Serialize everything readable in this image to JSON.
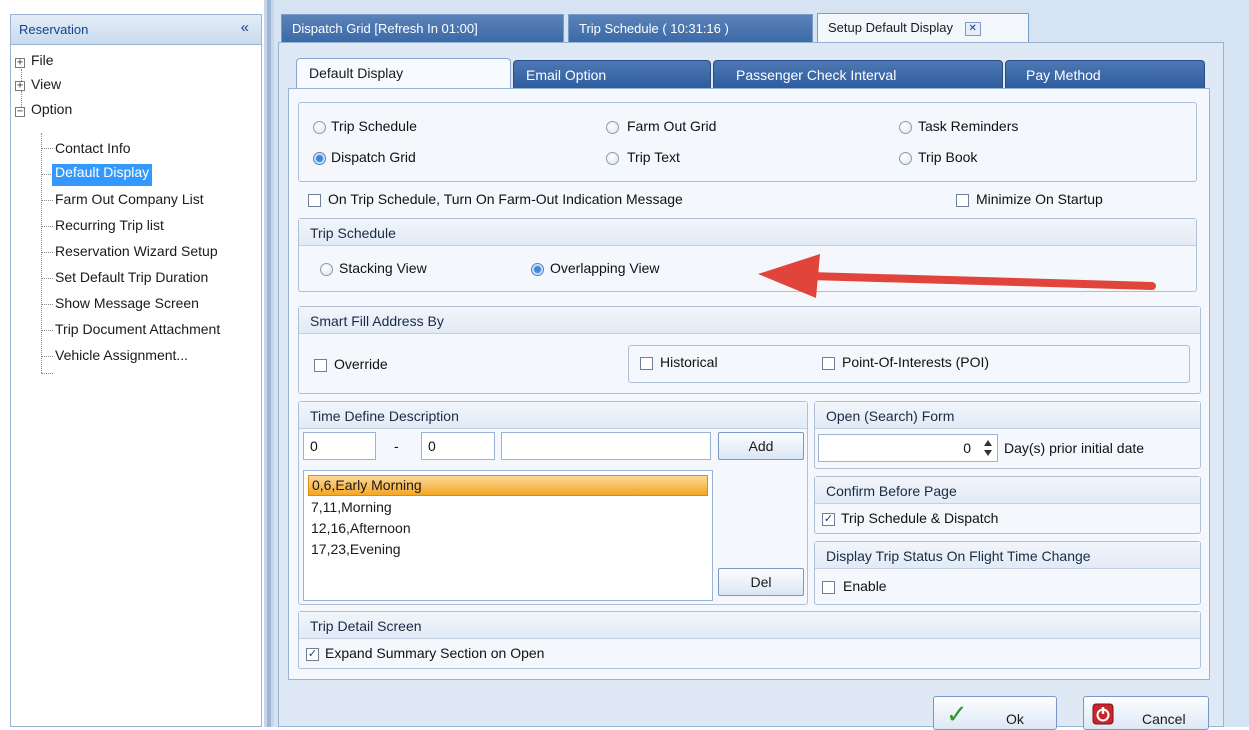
{
  "left_panel": {
    "title": "Reservation",
    "collapse_glyph": "«",
    "tree": {
      "file": "File",
      "view": "View",
      "option": "Option",
      "children": [
        "Contact Info",
        "Default Display",
        "Farm Out Company List",
        "Recurring Trip list",
        "Reservation Wizard Setup",
        "Set Default Trip Duration",
        "Show Message Screen",
        "Trip Document Attachment",
        "Vehicle Assignment..."
      ],
      "selected": "Default Display"
    }
  },
  "doc_tabs": {
    "dispatch": "Dispatch Grid [Refresh In 01:00]",
    "schedule": "Trip Schedule  ( 10:31:16 )",
    "setup": "Setup Default Display",
    "close_glyph": "✕"
  },
  "sub_tabs": {
    "default_display": "Default Display",
    "email_option": "Email Option",
    "passenger_check": "Passenger Check Interval",
    "pay_method": "Pay Method"
  },
  "default_view": {
    "trip_schedule": "Trip Schedule",
    "farm_out_grid": "Farm Out Grid",
    "task_reminders": "Task Reminders",
    "dispatch_grid": "Dispatch Grid",
    "trip_text": "Trip Text",
    "trip_book": "Trip Book",
    "selected": "Dispatch Grid"
  },
  "options": {
    "farm_out_msg": "On Trip Schedule, Turn On Farm-Out Indication Message",
    "minimize": "Minimize On Startup"
  },
  "trip_schedule_group": {
    "title": "Trip Schedule",
    "stacking": "Stacking View",
    "overlapping": "Overlapping View",
    "selected": "Overlapping View"
  },
  "smart_fill": {
    "title": "Smart Fill Address By",
    "override": "Override",
    "historical": "Historical",
    "poi": "Point-Of-Interests (POI)"
  },
  "time_define": {
    "title": "Time Define Description",
    "from": "0",
    "dash": "-",
    "to": "0",
    "description": "",
    "add_label": "Add",
    "del_label": "Del",
    "items": [
      "0,6,Early Morning",
      "7,11,Morning",
      "12,16,Afternoon",
      "17,23,Evening"
    ],
    "selected_index": 0
  },
  "open_search": {
    "title": "Open (Search) Form",
    "days_value": "0",
    "days_label": "Day(s) prior initial date"
  },
  "confirm_before_page": {
    "title": "Confirm Before Page",
    "label": "Trip Schedule & Dispatch",
    "checked": true
  },
  "flight_status": {
    "title": "Display Trip Status On Flight Time Change",
    "label": "Enable",
    "checked": false
  },
  "trip_detail": {
    "title": "Trip Detail Screen",
    "label": "Expand Summary Section on Open",
    "checked": true
  },
  "footer": {
    "ok_label": "Ok",
    "cancel_label": "Cancel"
  },
  "colors": {
    "accent_blue": "#2e5d9e",
    "selection_orange": "#f5a623",
    "arrow_red": "#e0443b",
    "tree_selection": "#3399ff"
  },
  "icons": {
    "check_mark": "✓",
    "cancel": "power-icon"
  }
}
